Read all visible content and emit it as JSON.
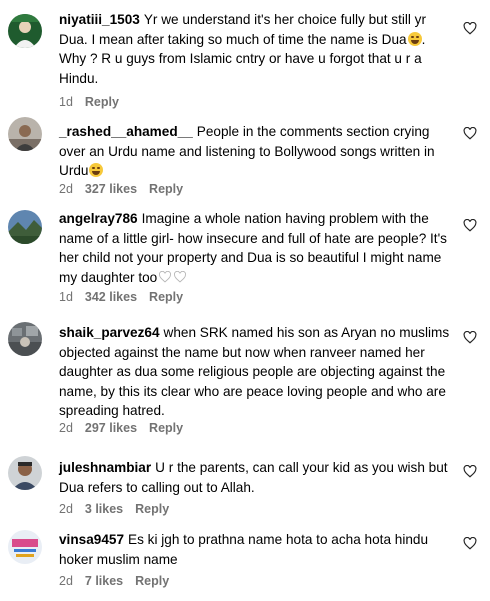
{
  "comments": [
    {
      "username": "niyatiii_1503",
      "text": "Yr we understand it's her choice fully but still yr Dua. I mean after taking so much of time the name is Dua",
      "text_after": ". Why ? R u guys from Islamic cntry or have u forgot that u r a Hindu.",
      "age": "1d",
      "likes": "",
      "reply": "Reply"
    },
    {
      "username": "_rashed__ahamed__",
      "text": "People in the comments section crying over an Urdu name and listening to Bollywood songs written in Urdu",
      "text_after": "",
      "age": "2d",
      "likes": "327 likes",
      "reply": "Reply"
    },
    {
      "username": "angelray786",
      "text": "Imagine a whole nation having problem with the name of a little girl- how insecure and full of hate are people? It's her child not your property and Dua is so beautiful I might name my daughter too",
      "text_after": "",
      "age": "1d",
      "likes": "342 likes",
      "reply": "Reply"
    },
    {
      "username": "shaik_parvez64",
      "text": "when SRK named his son as Aryan no muslims objected against the name but now when ranveer named her daughter as dua some religious people are objecting against the name, by this its clear who are peace loving people and who are spreading hatred.",
      "text_after": "",
      "age": "2d",
      "likes": "297 likes",
      "reply": "Reply"
    },
    {
      "username": "juleshnambiar",
      "text": "U r the parents, can call your kid as you wish but Dua refers to calling out to Allah.",
      "text_after": "",
      "age": "2d",
      "likes": "3 likes",
      "reply": "Reply"
    },
    {
      "username": "vinsa9457",
      "text": "Es ki jgh to prathna name hota to acha hota hindu hoker muslim name",
      "text_after": "",
      "age": "2d",
      "likes": "7 likes",
      "reply": "Reply"
    }
  ],
  "icons": {
    "like": "heart-outline-icon",
    "emoji_laugh": "face-with-tears-of-joy-icon",
    "inline_heart": "white-heart-emoji-icon"
  },
  "colors": {
    "meta": "#737373",
    "text": "#000000"
  }
}
